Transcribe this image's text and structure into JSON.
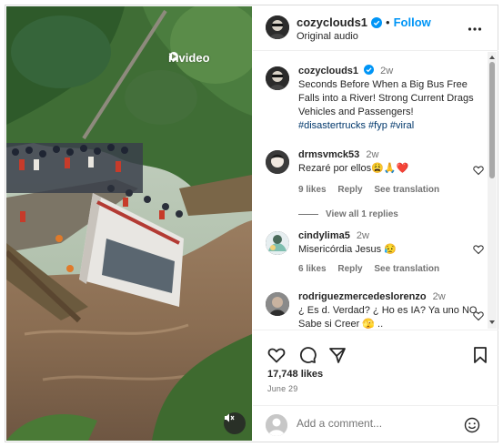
{
  "post": {
    "watermark": "invideo",
    "author": {
      "username": "cozyclouds1",
      "follow_label": "Follow",
      "separator": "•",
      "audio": "Original audio"
    },
    "caption": {
      "username": "cozyclouds1",
      "time": "2w",
      "text": "Seconds Before When a Big Bus Free Falls into a River! Strong Current Drags Vehicles and Passengers!",
      "hashtags": [
        "#disastertrucks",
        "#fyp",
        "#viral"
      ]
    },
    "comments": [
      {
        "username": "drmsvmck53",
        "time": "2w",
        "text": "Rezaré por ellos😩🙏❤️",
        "likes": "9 likes",
        "reply_label": "Reply",
        "translate_label": "See translation",
        "view_replies": "View all 1 replies"
      },
      {
        "username": "cindylima5",
        "time": "2w",
        "text": "Misericórdia Jesus 😥",
        "likes": "6 likes",
        "reply_label": "Reply",
        "translate_label": "See translation"
      },
      {
        "username": "rodriguezmercedeslorenzo",
        "time": "2w",
        "text": "¿ Es d. Verdad? ¿ Ho es IA? Ya uno NO Sabe si Creer 🫣 .."
      }
    ],
    "likes_count": "17,748 likes",
    "date": "June 29",
    "add_comment_placeholder": "Add a comment..."
  },
  "icons": {
    "more": "more-options-icon",
    "heart": "heart-icon",
    "comment": "comment-icon",
    "share": "share-icon",
    "save": "bookmark-icon",
    "emoji": "emoji-icon",
    "mute": "muted-speaker-icon",
    "verified": "verified-badge-icon"
  },
  "colors": {
    "link": "#0095f6",
    "hashtag": "#00376b",
    "muted_text": "#737373",
    "border": "#dbdbdb"
  }
}
